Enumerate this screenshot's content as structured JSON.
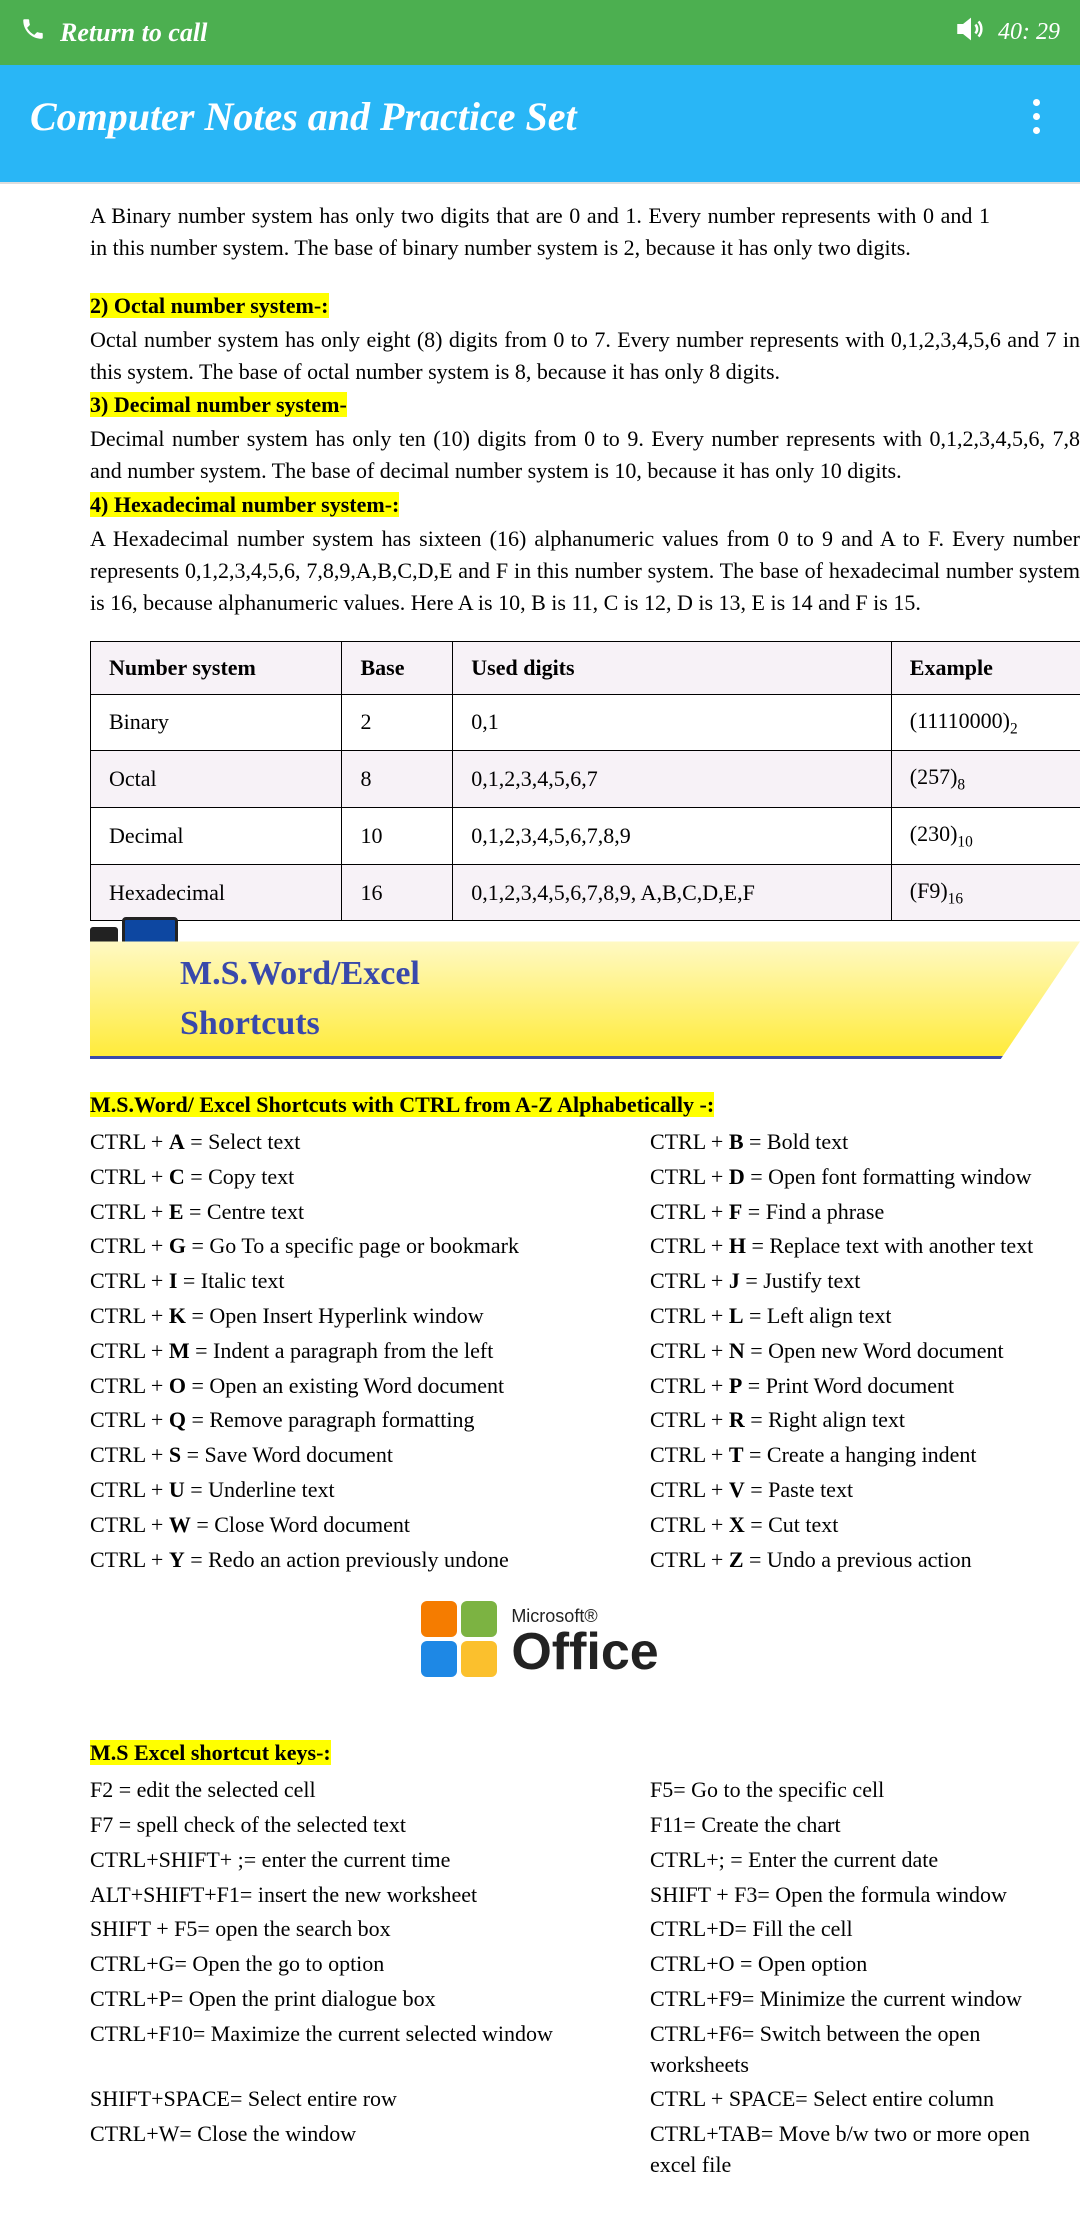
{
  "callbar": {
    "return": "Return to call",
    "timer": "40: 29"
  },
  "header": {
    "title": "Computer Notes and Practice Set"
  },
  "intro": "A Binary number system has only two digits that are 0 and 1. Every number represents with 0 and 1 in this number system. The base of binary number system is 2, because it has only two digits.",
  "sections": {
    "octal_h": "2) Octal number system-:",
    "octal_p": "Octal number system has only eight (8) digits from 0 to 7. Every number represents with 0,1,2,3,4,5,6 and 7 in this system. The base of octal number system is 8, because it has only 8 digits.",
    "dec_h": "3) Decimal number system-",
    "dec_p": "Decimal number system has only ten (10) digits from 0 to 9. Every number represents with 0,1,2,3,4,5,6, 7,8 and number system. The base of decimal number system is 10, because it has only 10 digits.",
    "hex_h": "4) Hexadecimal number system-:",
    "hex_p": "A Hexadecimal number system has sixteen (16) alphanumeric values from 0 to 9 and A to F. Every number represents 0,1,2,3,4,5,6, 7,8,9,A,B,C,D,E and F in this number system. The base of hexadecimal number system is 16, because alphanumeric values. Here A is 10, B is 11, C is 12, D is 13, E is 14 and F is 15."
  },
  "table": {
    "headers": [
      "Number system",
      "Base",
      "Used digits",
      "Example"
    ],
    "rows": [
      {
        "ns": "Binary",
        "base": "2",
        "digits": "0,1",
        "ex": "(11110000)",
        "sub": "2"
      },
      {
        "ns": "Octal",
        "base": "8",
        "digits": "0,1,2,3,4,5,6,7",
        "ex": "(257)",
        "sub": "8"
      },
      {
        "ns": "Decimal",
        "base": "10",
        "digits": "0,1,2,3,4,5,6,7,8,9",
        "ex": "(230)",
        "sub": "10"
      },
      {
        "ns": "Hexadecimal",
        "base": "16",
        "digits": "0,1,2,3,4,5,6,7,8,9, A,B,C,D,E,F",
        "ex": "(F9)",
        "sub": "16"
      }
    ]
  },
  "banner": "M.S.Word/Excel Shortcuts",
  "word_head": "M.S.Word/ Excel Shortcuts with CTRL from A-Z Alphabetically -:",
  "word_shortcuts": [
    {
      "l": "CTRL + <b>A</b> = Select text",
      "r": "CTRL + <b>B</b> = Bold text"
    },
    {
      "l": "CTRL + <b>C</b> = Copy text",
      "r": "CTRL + <b>D</b> = Open font formatting window"
    },
    {
      "l": "CTRL + <b>E</b> = Centre text",
      "r": "CTRL + <b>F</b> = Find a phrase"
    },
    {
      "l": "CTRL + <b>G</b> = Go To a specific page or bookmark",
      "r": "CTRL + <b>H</b> = Replace text with another text"
    },
    {
      "l": "CTRL + <b>I</b> = Italic text",
      "r": "CTRL + <b>J</b> = Justify text"
    },
    {
      "l": "CTRL + <b>K</b> = Open Insert Hyperlink window",
      "r": "CTRL + <b>L</b> = Left align text"
    },
    {
      "l": "CTRL + <b>M</b> = Indent a paragraph from the left",
      "r": "CTRL + <b>N</b> = Open new Word document"
    },
    {
      "l": "CTRL + <b>O</b> = Open an existing Word document",
      "r": "CTRL + <b>P</b> = Print Word document"
    },
    {
      "l": "CTRL + <b>Q</b> = Remove paragraph formatting",
      "r": "CTRL + <b>R</b> = Right align text"
    },
    {
      "l": "CTRL + <b>S</b> = Save Word document",
      "r": "CTRL + <b>T</b> = Create a hanging indent"
    },
    {
      "l": "CTRL + <b>U</b> = Underline text",
      "r": "CTRL + <b>V</b> = Paste text"
    },
    {
      "l": "CTRL + <b>W</b> = Close Word document",
      "r": "CTRL + <b>X</b> = Cut text"
    },
    {
      "l": "CTRL + <b>Y</b> = Redo an action previously undone",
      "r": "CTRL + <b>Z</b> = Undo a previous action"
    }
  ],
  "office": {
    "ms": "Microsoft®",
    "of": "Office"
  },
  "excel_head": "M.S Excel shortcut keys-:",
  "excel_shortcuts": [
    {
      "l": "F2 = edit the selected cell",
      "r": "F5= Go to the specific cell"
    },
    {
      "l": "F7 = spell check of the selected text",
      "r": "F11= Create the chart"
    },
    {
      "l": "CTRL+SHIFT+ ;= enter the current time",
      "r": "CTRL+; = Enter the current date"
    },
    {
      "l": "ALT+SHIFT+F1= insert the new worksheet",
      "r": "SHIFT + F3= Open the formula window"
    },
    {
      "l": "SHIFT + F5= open the search box",
      "r": "CTRL+D= Fill the cell"
    },
    {
      "l": "CTRL+G= Open the go to option",
      "r": "CTRL+O = Open option"
    },
    {
      "l": "CTRL+P= Open the print dialogue box",
      "r": "CTRL+F9= Minimize the current window"
    },
    {
      "l": "CTRL+F10= Maximize the current selected  window",
      "r": "CTRL+F6= Switch between the open worksheets"
    },
    {
      "l": "SHIFT+SPACE= Select entire row",
      "r": "CTRL + SPACE= Select entire column"
    },
    {
      "l": "CTRL+W= Close the window",
      "r": "CTRL+TAB= Move b/w two or more open excel file"
    }
  ]
}
